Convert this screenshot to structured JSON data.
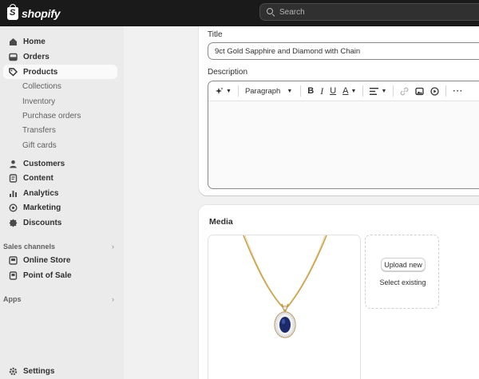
{
  "topbar": {
    "brand": "shopify",
    "search_placeholder": "Search"
  },
  "sidebar": {
    "main_items": [
      {
        "label": "Home",
        "icon": "home-icon"
      },
      {
        "label": "Orders",
        "icon": "inbox-icon"
      },
      {
        "label": "Products",
        "icon": "tag-icon",
        "active": true
      }
    ],
    "product_subitems": [
      "Collections",
      "Inventory",
      "Purchase orders",
      "Transfers",
      "Gift cards"
    ],
    "more_items": [
      {
        "label": "Customers",
        "icon": "person-icon"
      },
      {
        "label": "Content",
        "icon": "document-icon"
      },
      {
        "label": "Analytics",
        "icon": "bar-chart-icon"
      },
      {
        "label": "Marketing",
        "icon": "target-icon"
      },
      {
        "label": "Discounts",
        "icon": "discount-icon"
      }
    ],
    "sales_channels_label": "Sales channels",
    "channels": [
      {
        "label": "Online Store",
        "icon": "storefront-icon"
      },
      {
        "label": "Point of Sale",
        "icon": "pos-icon"
      }
    ],
    "apps_label": "Apps",
    "settings_label": "Settings"
  },
  "product_form": {
    "title_label": "Title",
    "title_value": "9ct Gold Sapphire and Diamond with Chain",
    "description_label": "Description",
    "toolbar": {
      "paragraph_label": "Paragraph",
      "bold": "B",
      "italic": "I",
      "underline": "U",
      "text_color": "A"
    }
  },
  "media": {
    "title": "Media",
    "upload_label": "Upload new",
    "select_existing_label": "Select existing"
  },
  "colors": {
    "topbar": "#1a1a1a",
    "sidebar": "#ebebeb",
    "background": "#f1f1f1",
    "card": "#ffffff"
  }
}
